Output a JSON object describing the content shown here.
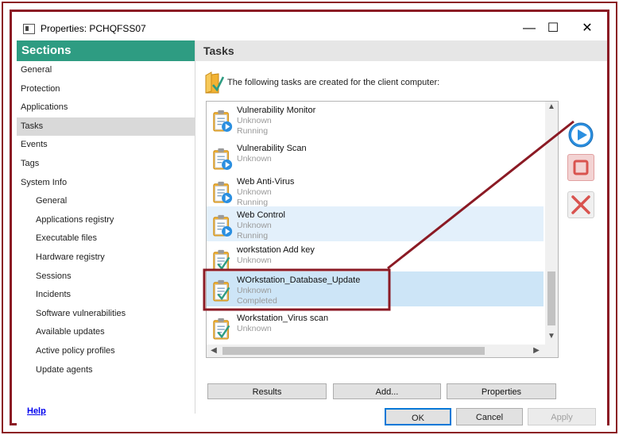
{
  "window": {
    "title": "Properties: PCHQFSS07",
    "controls": {
      "minimize": "—",
      "maximize": "☐",
      "close": "✕"
    }
  },
  "sidebar": {
    "header": "Sections",
    "items": [
      {
        "label": "General",
        "level": 0,
        "selected": false
      },
      {
        "label": "Protection",
        "level": 0,
        "selected": false
      },
      {
        "label": "Applications",
        "level": 0,
        "selected": false
      },
      {
        "label": "Tasks",
        "level": 0,
        "selected": true
      },
      {
        "label": "Events",
        "level": 0,
        "selected": false
      },
      {
        "label": "Tags",
        "level": 0,
        "selected": false
      },
      {
        "label": "System Info",
        "level": 0,
        "selected": false
      },
      {
        "label": "General",
        "level": 1,
        "selected": false
      },
      {
        "label": "Applications registry",
        "level": 1,
        "selected": false
      },
      {
        "label": "Executable files",
        "level": 1,
        "selected": false
      },
      {
        "label": "Hardware registry",
        "level": 1,
        "selected": false
      },
      {
        "label": "Sessions",
        "level": 1,
        "selected": false
      },
      {
        "label": "Incidents",
        "level": 1,
        "selected": false
      },
      {
        "label": "Software vulnerabilities",
        "level": 1,
        "selected": false
      },
      {
        "label": "Available updates",
        "level": 1,
        "selected": false
      },
      {
        "label": "Active policy profiles",
        "level": 1,
        "selected": false
      },
      {
        "label": "Update agents",
        "level": 1,
        "selected": false
      }
    ]
  },
  "main": {
    "header": "Tasks",
    "intro": "The following tasks are created for the client computer:",
    "tasks": [
      {
        "name": "Vulnerability Monitor",
        "status": "Unknown",
        "state": "Running",
        "icon": "task-running-icon",
        "highlight": "none"
      },
      {
        "name": "Vulnerability Scan",
        "status": "Unknown",
        "state": "",
        "icon": "task-running-icon",
        "highlight": "none"
      },
      {
        "name": "Web Anti-Virus",
        "status": "Unknown",
        "state": "Running",
        "icon": "task-running-icon",
        "highlight": "none"
      },
      {
        "name": "Web Control",
        "status": "Unknown",
        "state": "Running",
        "icon": "task-running-icon",
        "highlight": "hover"
      },
      {
        "name": "workstation Add key",
        "status": "Unknown",
        "state": "",
        "icon": "task-completed-icon",
        "highlight": "none"
      },
      {
        "name": "WOrkstation_Database_Update",
        "status": "Unknown",
        "state": "Completed",
        "icon": "task-completed-icon",
        "highlight": "selected"
      },
      {
        "name": "Workstation_Virus scan",
        "status": "Unknown",
        "state": "",
        "icon": "task-completed-icon",
        "highlight": "none"
      }
    ],
    "buttons": {
      "results": "Results",
      "add": "Add...",
      "properties": "Properties"
    },
    "actions": {
      "start": "start-task-icon",
      "stop": "stop-task-icon",
      "delete": "delete-task-icon"
    }
  },
  "footer": {
    "help": "Help",
    "ok": "OK",
    "cancel": "Cancel",
    "apply": "Apply"
  },
  "colors": {
    "accent": "#2e9c82",
    "annotation": "#8b1a24",
    "selection": "#cde5f7",
    "play": "#2b8fe0",
    "stop": "#d9534f",
    "delete": "#d9534f"
  }
}
